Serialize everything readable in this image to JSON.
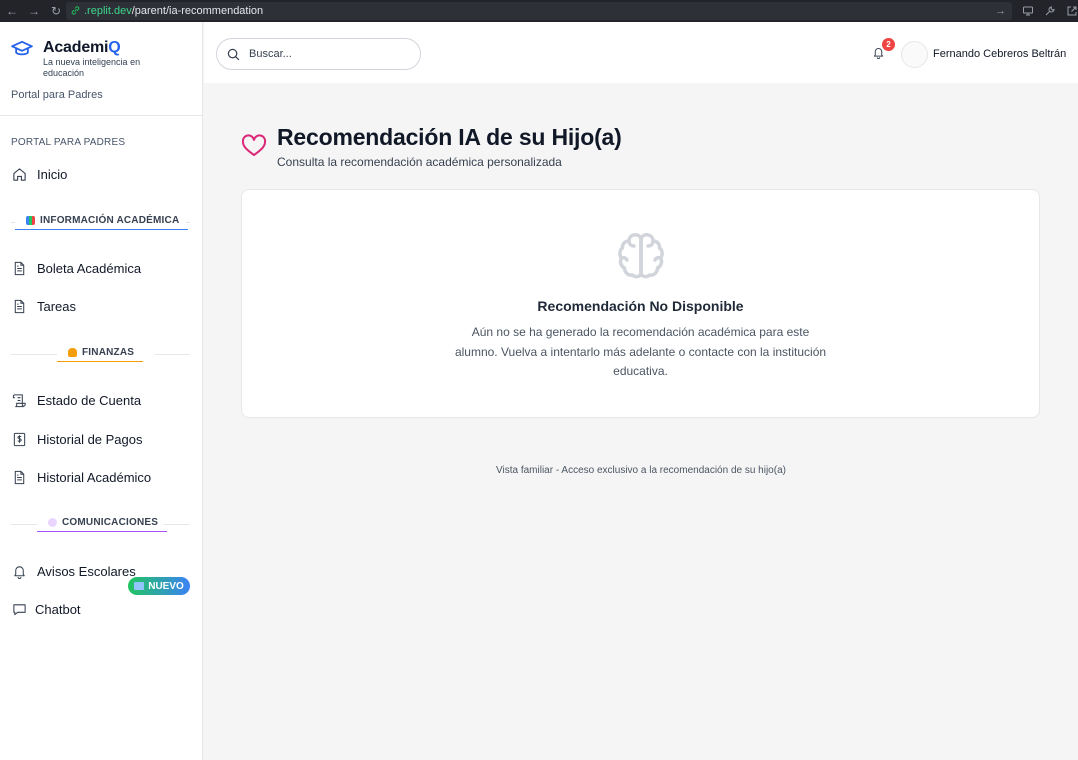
{
  "browser": {
    "url_host": ".replit.dev",
    "url_path": "/parent/ia-recommendation"
  },
  "brand": {
    "name_main": "Academi",
    "name_accent": "Q",
    "tagline": "La nueva inteligencia en educación",
    "portal": "Portal para Padres"
  },
  "sidebar": {
    "section_title": "PORTAL PARA PADRES",
    "inicio": "Inicio",
    "academic_header": "INFORMACIÓN ACADÉMICA",
    "boleta": "Boleta Académica",
    "tareas": "Tareas",
    "finance_header": "FINANZAS",
    "estado_cuenta": "Estado de Cuenta",
    "historial_pagos": "Historial de Pagos",
    "historial_academico": "Historial Académico",
    "comm_header": "COMUNICACIONES",
    "avisos": "Avisos Escolares",
    "chatbot": "Chatbot",
    "chatbot_badge": "NUEVO"
  },
  "header": {
    "search_placeholder": "Buscar...",
    "notification_count": "2",
    "user_name": "Fernando Cebreros Beltrán"
  },
  "main": {
    "title": "Recomendación IA de su Hijo(a)",
    "subtitle": "Consulta la recomendación académica personalizada",
    "empty_title": "Recomendación No Disponible",
    "empty_text": "Aún no se ha generado la recomendación académica para este alumno. Vuelva a intentarlo más adelante o contacte con la institución educativa.",
    "footer_note": "Vista familiar - Acceso exclusivo a la recomendación de su hijo(a)"
  },
  "colors": {
    "accent_blue": "#2563eb",
    "heart_pink": "#db2777",
    "notif_red": "#ef4444",
    "academic_line": "#3b82f6",
    "finance_line": "#f59e0b",
    "comm_line": "#a855f7"
  }
}
